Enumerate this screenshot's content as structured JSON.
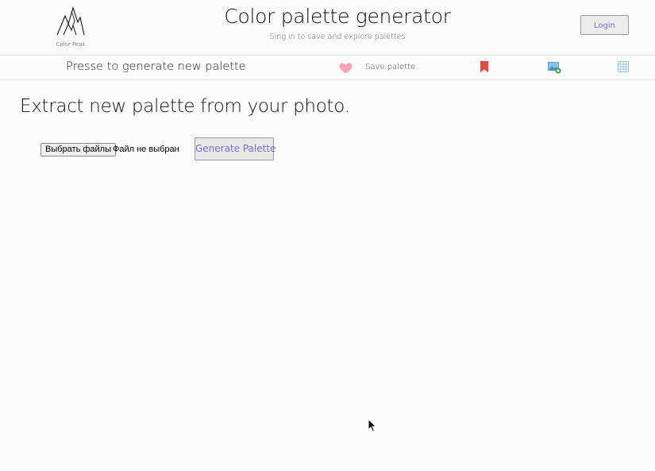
{
  "header": {
    "logo_text": "Color Peak",
    "title": "Color palette generator",
    "subtitle": "Sing in to save and explore palettes",
    "login_label": "Login"
  },
  "toolbar": {
    "hint": "Presse to generate new palette",
    "save_label": "Save palette",
    "icons": [
      "heart-icon",
      "bookmark-icon",
      "add-image-icon",
      "grid-icon"
    ]
  },
  "main": {
    "heading": "Extract new palette from your photo.",
    "file_button_label": "Выбрать файлы",
    "file_status": "Файл не выбран",
    "generate_label": "Generate Palette"
  },
  "colors": {
    "accent": "#7b6fd6",
    "heart": "#f5a3b6",
    "bookmark": "#e8473c",
    "image_icon": "#6aaed6",
    "grid": "#9cc8ef"
  }
}
